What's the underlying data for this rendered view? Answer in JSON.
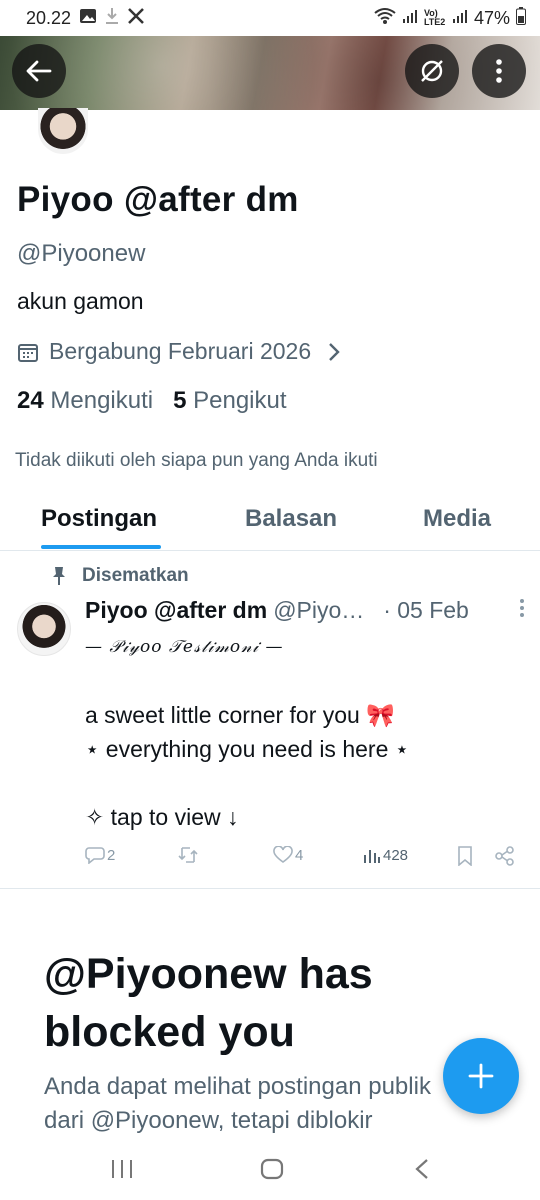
{
  "status_bar": {
    "time": "20.22",
    "battery": "47%",
    "network_label": "Vo) LTE2"
  },
  "profile": {
    "name": "Piyoo @after dm",
    "handle": "@Piyoonew",
    "bio": "akun gamon",
    "joined": "Bergabung Februari 2026",
    "following_count": "24",
    "following_label": "Mengikuti",
    "followers_count": "5",
    "followers_label": "Pengikut",
    "not_followed_text": "Tidak diikuti oleh siapa pun yang Anda ikuti"
  },
  "tabs": [
    {
      "label": "Postingan",
      "active": true
    },
    {
      "label": "Balasan",
      "active": false
    },
    {
      "label": "Media",
      "active": false
    }
  ],
  "post": {
    "pinned_label": "Disematkan",
    "author_name": "Piyoo @after dm",
    "author_handle": "@Piyo…",
    "date": "· 05 Feb",
    "lines": [
      "— 𝒫𝒾𝓎𝑜𝑜 𝒯𝑒𝓈𝓉𝒾𝓂𝑜𝓃𝒾 —",
      "",
      "a sweet little corner for you 🎀",
      "⋆ everything you need is here ⋆",
      "",
      "✧ tap to view ↓"
    ],
    "replies": "2",
    "retweets": "",
    "likes": "4",
    "views": "428"
  },
  "blocked": {
    "title": "@Piyoonew has blocked you",
    "description": "Anda dapat melihat postingan publik dari @Piyoonew, tetapi diblokir"
  },
  "colors": {
    "accent": "#1d9bf0",
    "text_primary": "#0f1419",
    "text_secondary": "#536471"
  }
}
